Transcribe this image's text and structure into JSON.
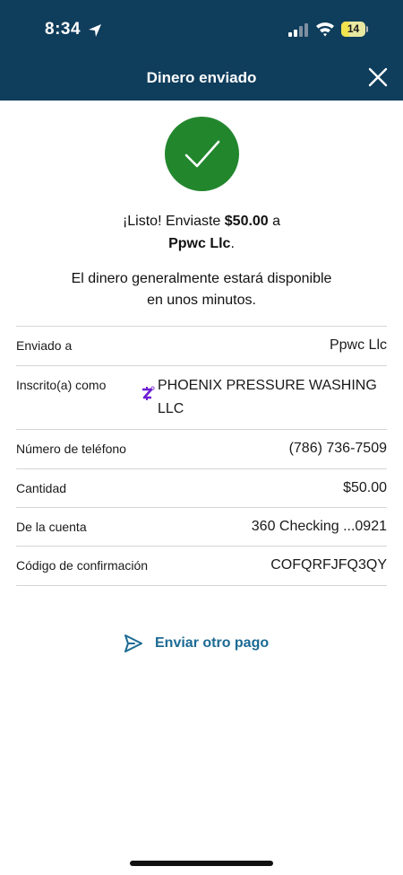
{
  "status_bar": {
    "time": "8:34",
    "battery": "14",
    "icons": [
      "location-arrow-icon",
      "cellular-signal-icon",
      "wifi-icon",
      "battery-icon"
    ]
  },
  "header": {
    "title": "Dinero enviado",
    "close_icon": "close-icon",
    "background_color": "#0f3d5c"
  },
  "success": {
    "icon": "checkmark-icon",
    "color": "#22862d",
    "message_prefix": "¡Listo! Enviaste ",
    "amount": "$50.00",
    "message_mid": " a",
    "recipient": "Ppwc Llc",
    "message_end": ".",
    "note_line1": "El dinero generalmente estará disponible",
    "note_line2": "en unos minutos."
  },
  "details": [
    {
      "label": "Enviado a",
      "value": "Ppwc Llc"
    },
    {
      "label": "Inscrito(a) como",
      "value_line1": "PHOENIX PRESSURE WASHING",
      "value_line2": "LLC",
      "icon": "zelle-icon"
    },
    {
      "label": "Número de teléfono",
      "value": "(786) 736-7509"
    },
    {
      "label": "Cantidad",
      "value": "$50.00"
    },
    {
      "label": "De la cuenta",
      "value": "360 Checking ...0921"
    },
    {
      "label": "Código de confirmación",
      "value": "COFQRFJFQ3QY"
    }
  ],
  "actions": {
    "send_again_label": "Enviar otro pago",
    "send_icon": "paper-plane-icon",
    "link_color": "#1c6a93"
  }
}
